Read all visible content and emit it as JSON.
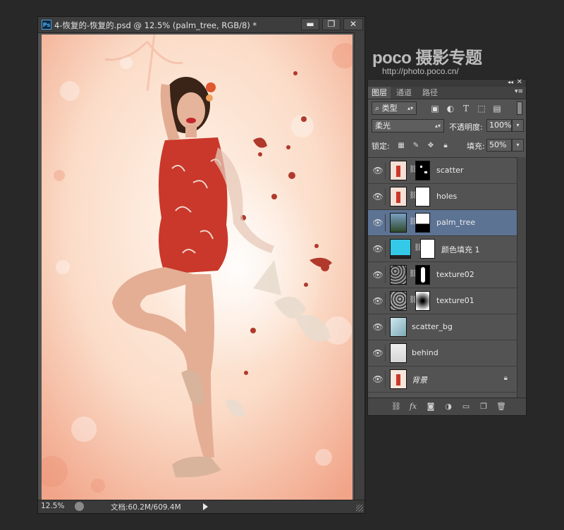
{
  "document": {
    "title": "4-恢复的-恢复的.psd @ 12.5% (palm_tree, RGB/8) *",
    "app_badge": "Ps",
    "buttons": {
      "minimize": "▬",
      "maximize": "❐",
      "close": "✕"
    },
    "status": {
      "zoom": "12.5%",
      "doc_size": "文档:60.2M/609.4M"
    }
  },
  "watermark": {
    "logo": "poco 摄影专题",
    "url": "http://photo.poco.cn/"
  },
  "layers_panel": {
    "header_icons": {
      "collapse": "◂◂",
      "close": "✕",
      "menu": "▾≡"
    },
    "tabs": [
      {
        "label": "图层",
        "active": true
      },
      {
        "label": "通道",
        "active": false
      },
      {
        "label": "路径",
        "active": false
      }
    ],
    "filter": {
      "kind_label": "类型",
      "search_glyph": "⌕"
    },
    "filter_icons": [
      "image-filter-icon",
      "adjustment-filter-icon",
      "type-filter-icon",
      "shape-filter-icon",
      "smart-object-filter-icon"
    ],
    "blend_mode": "柔光",
    "opacity": {
      "label": "不透明度:",
      "value": "100%"
    },
    "lock": {
      "label": "锁定:"
    },
    "fill": {
      "label": "填充:",
      "value": "50%"
    },
    "layers": [
      {
        "name": "scatter",
        "visible": true,
        "selected": false,
        "italic": false,
        "locked": false
      },
      {
        "name": "holes",
        "visible": true,
        "selected": false,
        "italic": false,
        "locked": false
      },
      {
        "name": "palm_tree",
        "visible": true,
        "selected": true,
        "italic": false,
        "locked": false
      },
      {
        "name": "颜色填充 1",
        "visible": true,
        "selected": false,
        "italic": false,
        "locked": false
      },
      {
        "name": "texture02",
        "visible": true,
        "selected": false,
        "italic": false,
        "locked": false
      },
      {
        "name": "texture01",
        "visible": true,
        "selected": false,
        "italic": false,
        "locked": false
      },
      {
        "name": "scatter_bg",
        "visible": true,
        "selected": false,
        "italic": false,
        "locked": false
      },
      {
        "name": "behind",
        "visible": true,
        "selected": false,
        "italic": false,
        "locked": false
      },
      {
        "name": "背景",
        "visible": true,
        "selected": false,
        "italic": true,
        "locked": true
      }
    ],
    "footer_buttons": [
      "link-layers-icon",
      "fx-icon",
      "add-mask-icon",
      "adjustment-layer-icon",
      "new-group-icon",
      "new-layer-icon",
      "trash-icon"
    ]
  },
  "colors": {
    "selected_layer": "#5c7394",
    "color_fill_swatch": "#35c9e8",
    "dress_red": "#c9382a"
  }
}
